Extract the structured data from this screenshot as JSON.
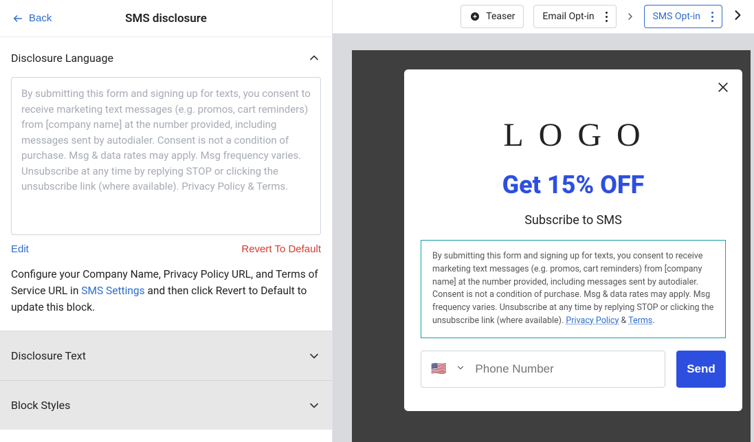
{
  "header": {
    "back_label": "Back",
    "title": "SMS disclosure",
    "teaser_label": "Teaser",
    "email_optin_label": "Email Opt-in",
    "sms_optin_label": "SMS Opt-in"
  },
  "section": {
    "disclosure_language_title": "Disclosure Language",
    "textarea_value": "By submitting this form and signing up for texts, you consent to receive marketing text messages (e.g. promos, cart reminders) from [company name] at the number provided, including messages sent by autodialer. Consent is not a condition of purchase. Msg & data rates may apply. Msg frequency varies. Unsubscribe at any time by replying STOP or clicking the unsubscribe link (where available). Privacy Policy & Terms.",
    "edit_label": "Edit",
    "revert_label": "Revert To Default",
    "help_prefix": "Configure your Company Name, Privacy Policy URL, and Terms of Service URL in ",
    "help_link": "SMS Settings",
    "help_suffix": " and then click Revert to Default to update this block."
  },
  "collapsed": {
    "disclosure_text": "Disclosure Text",
    "block_styles": "Block Styles"
  },
  "popup": {
    "logo": "LOGO",
    "headline": "Get 15% OFF",
    "subhead": "Subscribe to SMS",
    "disclosure_text": "By submitting this form and signing up for texts, you consent to receive marketing text messages (e.g. promos, cart reminders) from [company name] at the number provided, including messages sent by autodialer. Consent is not a condition of purchase. Msg & data rates may apply. Msg frequency varies. Unsubscribe at any time by replying STOP or clicking the unsubscribe link (where available). ",
    "privacy_label": "Privacy Policy",
    "amp": " & ",
    "terms_label": "Terms",
    "period": ".",
    "phone_placeholder": "Phone Number",
    "flag_emoji": "🇺🇸",
    "send_label": "Send"
  }
}
